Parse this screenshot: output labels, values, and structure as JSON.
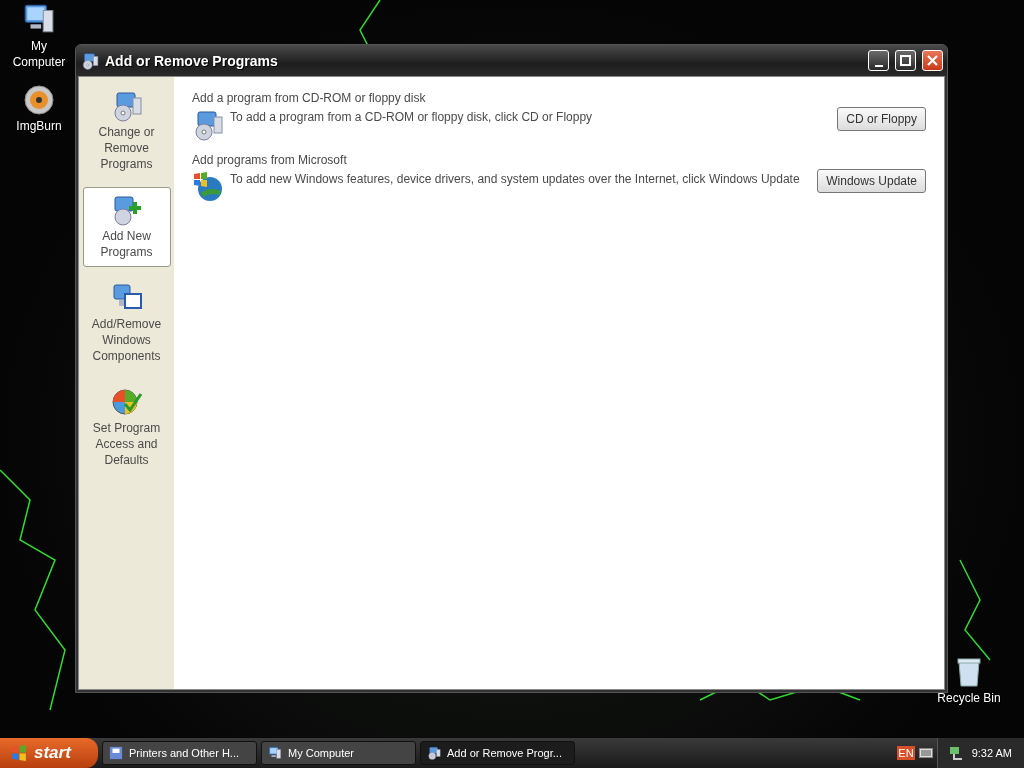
{
  "desktop_icons": [
    {
      "label": "My Computer",
      "kind": "computer"
    },
    {
      "label": "ImgBurn",
      "kind": "disc"
    }
  ],
  "recycle_bin": {
    "label": "Recycle Bin"
  },
  "window": {
    "title": "Add or Remove Programs",
    "sidebar": [
      {
        "label": "Change or Remove Programs",
        "kind": "change",
        "selected": false
      },
      {
        "label": "Add New Programs",
        "kind": "add",
        "selected": true
      },
      {
        "label": "Add/Remove Windows Components",
        "kind": "components",
        "selected": false
      },
      {
        "label": "Set Program Access and Defaults",
        "kind": "defaults",
        "selected": false
      }
    ],
    "sections": [
      {
        "heading": "Add a program from CD-ROM or floppy disk",
        "kind": "cd",
        "text": "To add a program from a CD-ROM or floppy disk, click CD or Floppy",
        "button": "CD or Floppy"
      },
      {
        "heading": "Add programs from Microsoft",
        "kind": "globe",
        "text": "To add new Windows features, device drivers, and system updates over the Internet, click Windows Update",
        "button": "Windows Update"
      }
    ]
  },
  "taskbar": {
    "start": "start",
    "tasks": [
      {
        "label": "Printers and Other H...",
        "kind": "printer",
        "selected": false
      },
      {
        "label": "My Computer",
        "kind": "computer",
        "selected": false
      },
      {
        "label": "Add or Remove Progr...",
        "kind": "programs",
        "selected": true
      }
    ],
    "language": "EN",
    "time": "9:32 AM"
  }
}
